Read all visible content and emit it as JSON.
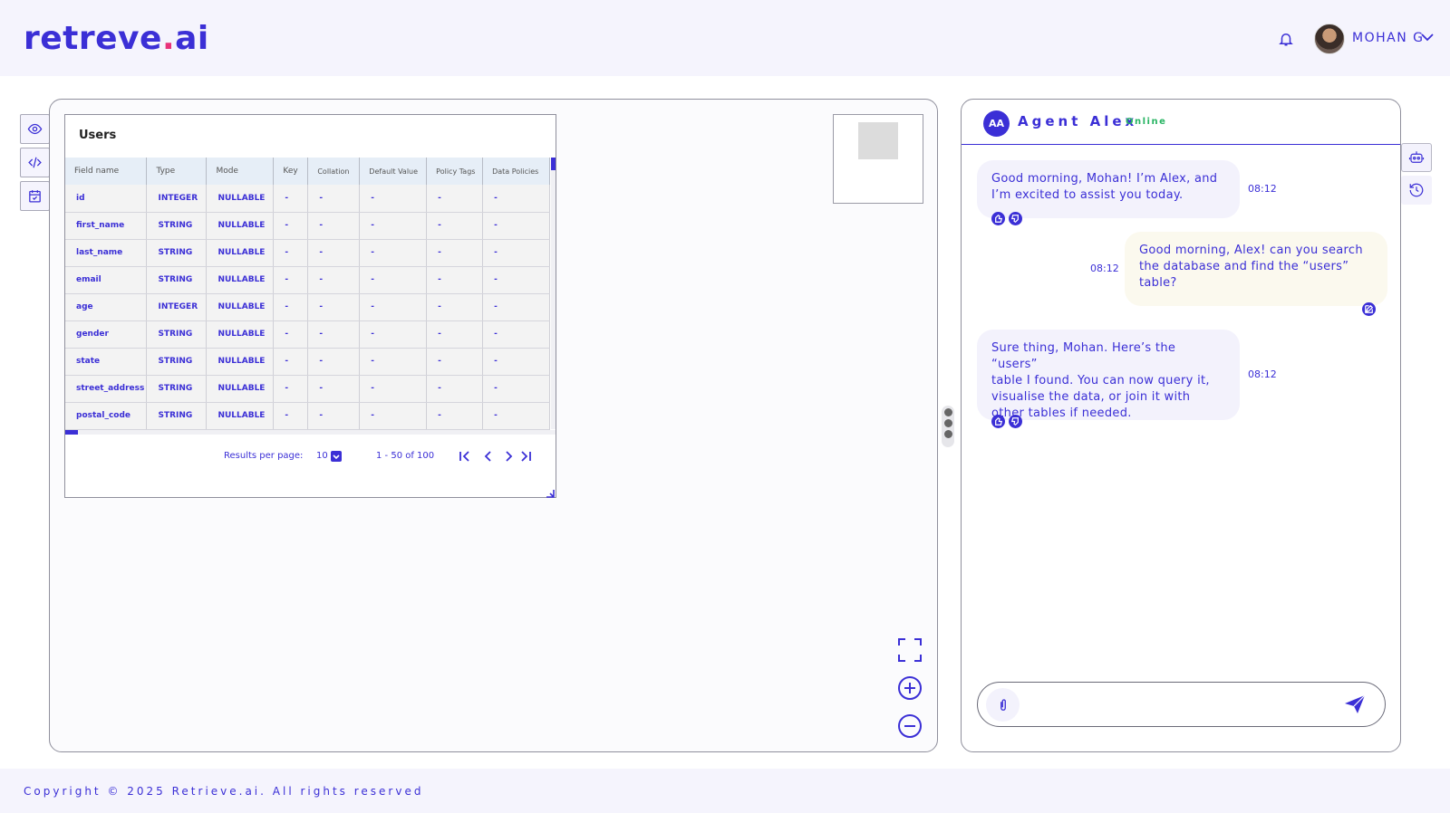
{
  "app": {
    "logo_main": "retreve",
    "logo_dot": ".",
    "logo_suffix": "ai",
    "user_name": "MOHAN G",
    "accent_color": "#3b2fd6",
    "icons": [
      "bell-icon",
      "chevron-down-icon",
      "eye-icon",
      "code-icon",
      "calendar-icon",
      "fullscreen-icon",
      "zoom-in-icon",
      "zoom-out-icon",
      "paperclip-icon",
      "send-icon",
      "robot-icon",
      "history-icon"
    ]
  },
  "table": {
    "title": "Users",
    "columns": [
      "Field name",
      "Type",
      "Mode",
      "Key",
      "Collation",
      "Default Value",
      "Policy Tags",
      "Data Policies"
    ],
    "rows": [
      [
        "id",
        "INTEGER",
        "NULLABLE",
        "-",
        "-",
        "-",
        "-",
        "-"
      ],
      [
        "first_name",
        "STRING",
        "NULLABLE",
        "-",
        "-",
        "-",
        "-",
        "-"
      ],
      [
        "last_name",
        "STRING",
        "NULLABLE",
        "-",
        "-",
        "-",
        "-",
        "-"
      ],
      [
        "email",
        "STRING",
        "NULLABLE",
        "-",
        "-",
        "-",
        "-",
        "-"
      ],
      [
        "age",
        "INTEGER",
        "NULLABLE",
        "-",
        "-",
        "-",
        "-",
        "-"
      ],
      [
        "gender",
        "STRING",
        "NULLABLE",
        "-",
        "-",
        "-",
        "-",
        "-"
      ],
      [
        "state",
        "STRING",
        "NULLABLE",
        "-",
        "-",
        "-",
        "-",
        "-"
      ],
      [
        "street_address",
        "STRING",
        "NULLABLE",
        "-",
        "-",
        "-",
        "-",
        "-"
      ],
      [
        "postal_code",
        "STRING",
        "NULLABLE",
        "-",
        "-",
        "-",
        "-",
        "-"
      ]
    ],
    "pager": {
      "results_label": "Results per page:",
      "per_page": "10",
      "range": "1 - 50 of 100"
    }
  },
  "chat": {
    "avatar_initials": "AA",
    "agent_name": "Agent Alex",
    "status": "Online",
    "messages": [
      {
        "from": "agent",
        "lines": [
          "Good morning, Mohan! I’m Alex, and",
          "I’m excited to assist you today."
        ],
        "time": "08:12"
      },
      {
        "from": "user",
        "lines": [
          "Good morning, Alex! can you search",
          "the database and find the “users”",
          "table?"
        ],
        "time": "08:12"
      },
      {
        "from": "agent",
        "lines": [
          "Sure thing, Mohan. Here’s the “users”",
          "table I found. You can now query it,",
          "visualise the data, or join it with",
          "other tables if needed."
        ],
        "time": "08:12"
      }
    ],
    "input_placeholder": ""
  },
  "footer": {
    "copyright": "Copyright © 2025 Retrieve.ai. All rights reserved"
  }
}
